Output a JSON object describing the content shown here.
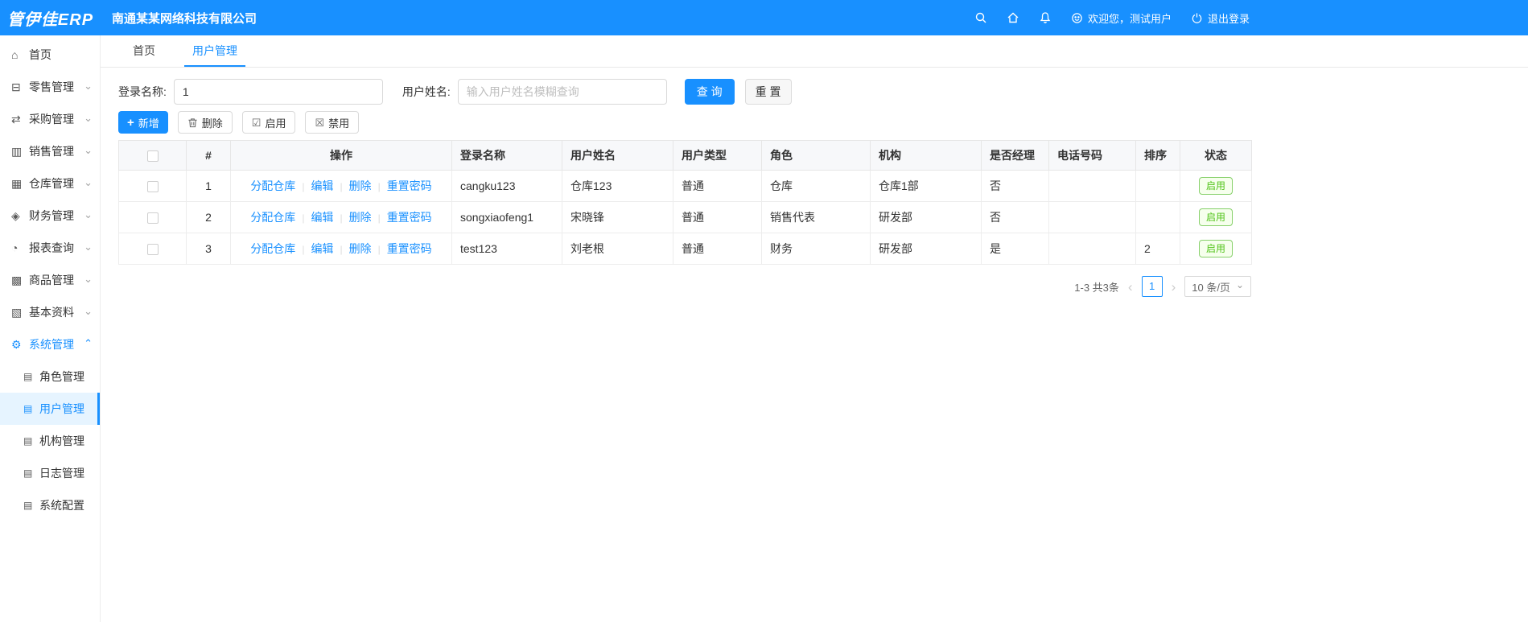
{
  "header": {
    "logo": "管伊佳ERP",
    "company": "南通某某网络科技有限公司",
    "welcome": "欢迎您，测试用户",
    "logout": "退出登录"
  },
  "icons": {
    "chevron_down": "⌄",
    "chevron_up": "⌃",
    "doc": "▤",
    "plus": "+",
    "check_square": "☑",
    "cross_square": "☒",
    "prev": "‹",
    "next": "›"
  },
  "colors": {
    "primary": "#1890ff",
    "success": "#52c41a"
  },
  "sidebar": {
    "items": [
      {
        "label": "首页",
        "glyph": "⌂"
      },
      {
        "label": "零售管理",
        "glyph": "⊟"
      },
      {
        "label": "采购管理",
        "glyph": "⇄"
      },
      {
        "label": "销售管理",
        "glyph": "▥"
      },
      {
        "label": "仓库管理",
        "glyph": "▦"
      },
      {
        "label": "财务管理",
        "glyph": "◈"
      },
      {
        "label": "报表查询",
        "glyph": "◔"
      },
      {
        "label": "商品管理",
        "glyph": "▩"
      },
      {
        "label": "基本资料",
        "glyph": "▧"
      },
      {
        "label": "系统管理",
        "glyph": "⚙"
      }
    ],
    "system_children": [
      "角色管理",
      "用户管理",
      "机构管理",
      "日志管理",
      "系统配置"
    ]
  },
  "tabs": [
    {
      "label": "首页"
    },
    {
      "label": "用户管理"
    }
  ],
  "filters": {
    "login_name_label": "登录名称:",
    "login_name_value": "1",
    "user_name_label": "用户姓名:",
    "user_name_placeholder": "输入用户姓名模糊查询",
    "search_button": "查 询",
    "reset_button": "重 置"
  },
  "toolbar": {
    "add": "新增",
    "delete": "删除",
    "enable": "启用",
    "disable": "禁用"
  },
  "table": {
    "columns": [
      "#",
      "操作",
      "登录名称",
      "用户姓名",
      "用户类型",
      "角色",
      "机构",
      "是否经理",
      "电话号码",
      "排序",
      "状态"
    ],
    "op_links": [
      "分配仓库",
      "编辑",
      "删除",
      "重置密码"
    ],
    "rows": [
      {
        "index": "1",
        "login_name": "cangku123",
        "user_name": "仓库123",
        "user_type": "普通",
        "role": "仓库",
        "org": "仓库1部",
        "is_manager": "否",
        "phone": "",
        "sort": "",
        "status": "启用"
      },
      {
        "index": "2",
        "login_name": "songxiaofeng1",
        "user_name": "宋晓锋",
        "user_type": "普通",
        "role": "销售代表",
        "org": "研发部",
        "is_manager": "否",
        "phone": "",
        "sort": "",
        "status": "启用"
      },
      {
        "index": "3",
        "login_name": "test123",
        "user_name": "刘老根",
        "user_type": "普通",
        "role": "财务",
        "org": "研发部",
        "is_manager": "是",
        "phone": "",
        "sort": "2",
        "status": "启用"
      }
    ]
  },
  "pagination": {
    "total": "1-3 共3条",
    "current_page": "1",
    "page_size": "10 条/页"
  }
}
